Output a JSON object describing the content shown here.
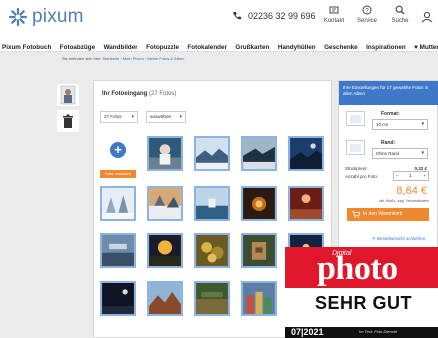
{
  "header": {
    "brand": "pixum",
    "phone": "02236 32 99 696",
    "kontakt": "Kontakt",
    "service": "Service",
    "suche": "Suche",
    "colors": {
      "brand": "#4d7fb8"
    }
  },
  "nav": {
    "items": [
      "Pixum Fotobuch",
      "Fotoabzüge",
      "Wandbilder",
      "Fotopuzzle",
      "Fotokalender",
      "Grußkarten",
      "Handyhüllen",
      "Geschenke",
      "Inspirationen",
      "♥ Muttertag"
    ]
  },
  "breadcrumb": {
    "prefix": "Sie befinden sich hier:",
    "path": "Startseite › Mein Pixum › Meine Fotos & Alben"
  },
  "main": {
    "title": "Ihr Fotoeingang",
    "count": "(27 Fotos)",
    "filter_value": "27 Fotos",
    "select_label": "auswählen",
    "add_label": "Fotos hochladen"
  },
  "order": {
    "head": "Ihre Einstellungen für 17 gewählte Fotos in allen Alben",
    "format_label": "Format:",
    "format_value": "10 cm",
    "rand_label": "Rand:",
    "rand_value": "Ohne Rand",
    "unit_price_label": "Stückpreis:",
    "unit_price": "0,32 €",
    "qty_label": "Anzahl pro Foto:",
    "qty_value": "1",
    "total": "8,64 €",
    "total_note": "inkl. MwSt., zzgl. Versandkosten",
    "cart_button": "In den Warenkorb",
    "close_link": "✕ Bestellansicht schließen",
    "colors": {
      "accent": "#3f77c9",
      "cta": "#f08830"
    }
  },
  "badge": {
    "digital": "Digital",
    "photo": "photo",
    "rating": "SEHR GUT",
    "issue": "07|2021",
    "note": "Im Test: Foto-Dienste",
    "colors": {
      "red": "#e0172b"
    }
  }
}
